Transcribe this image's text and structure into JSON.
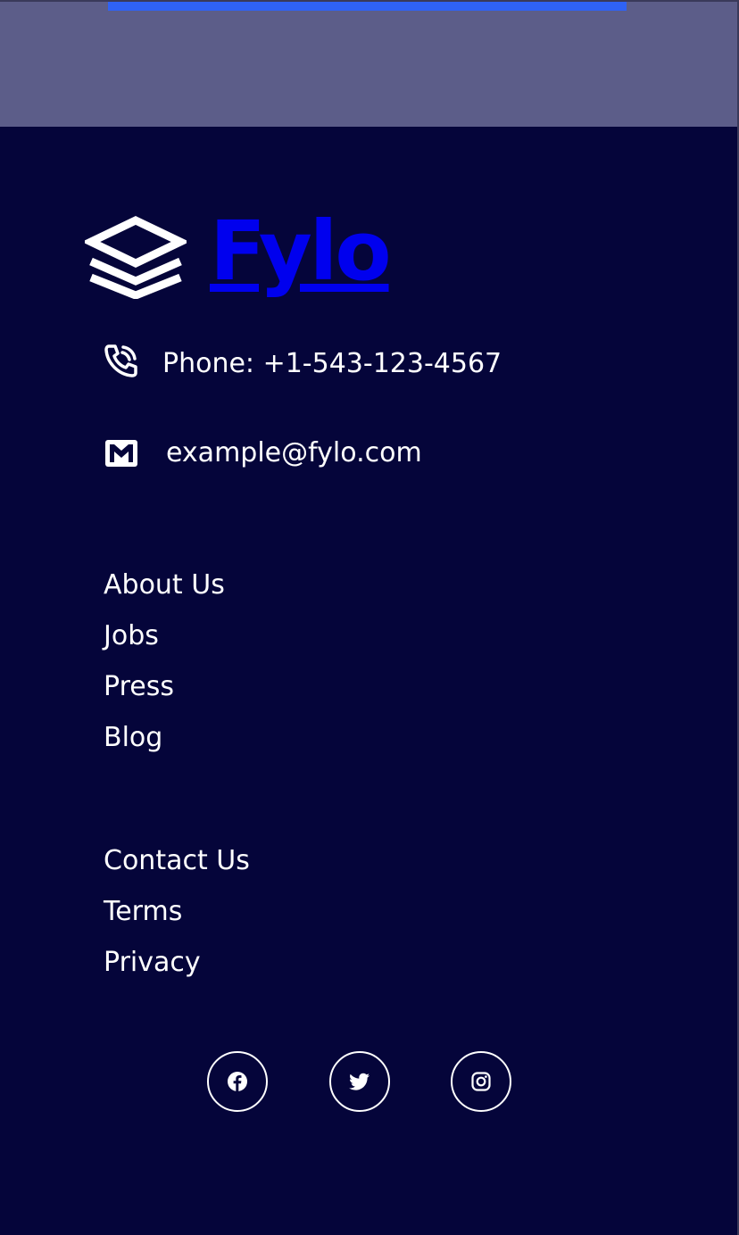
{
  "brand": {
    "name": "Fylo",
    "logo_icon": "stacked-layers-icon"
  },
  "contact": {
    "phone": "Phone: +1-543-123-4567",
    "phone_icon": "phone-ringing-icon",
    "email": "example@fylo.com",
    "email_icon": "mail-icon"
  },
  "links": {
    "primary": [
      "About Us",
      "Jobs",
      "Press",
      "Blog"
    ],
    "secondary": [
      "Contact Us",
      "Terms",
      "Privacy"
    ]
  },
  "social": [
    {
      "name": "facebook",
      "icon": "facebook-icon"
    },
    {
      "name": "twitter",
      "icon": "twitter-icon"
    },
    {
      "name": "instagram",
      "icon": "instagram-icon"
    }
  ],
  "colors": {
    "footer_bg": "#05053a",
    "top_band": "#5c5d89",
    "accent": "#2f62f5",
    "text": "#ffffff"
  }
}
